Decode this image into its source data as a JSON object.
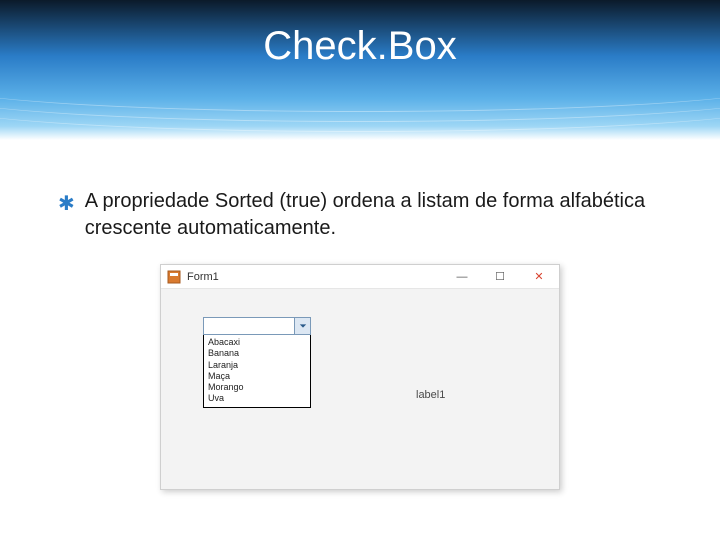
{
  "slide": {
    "title": "Check.Box",
    "bullet_marker": "✱",
    "bullet_text": "A propriedade Sorted (true) ordena a listam de forma alfabética crescente automaticamente."
  },
  "window": {
    "title": "Form1",
    "min": "—",
    "max": "☐",
    "close": "✕"
  },
  "combo": {
    "items": [
      "Abacaxi",
      "Banana",
      "Laranja",
      "Maça",
      "Morango",
      "Uva"
    ]
  },
  "label": {
    "text": "label1"
  }
}
